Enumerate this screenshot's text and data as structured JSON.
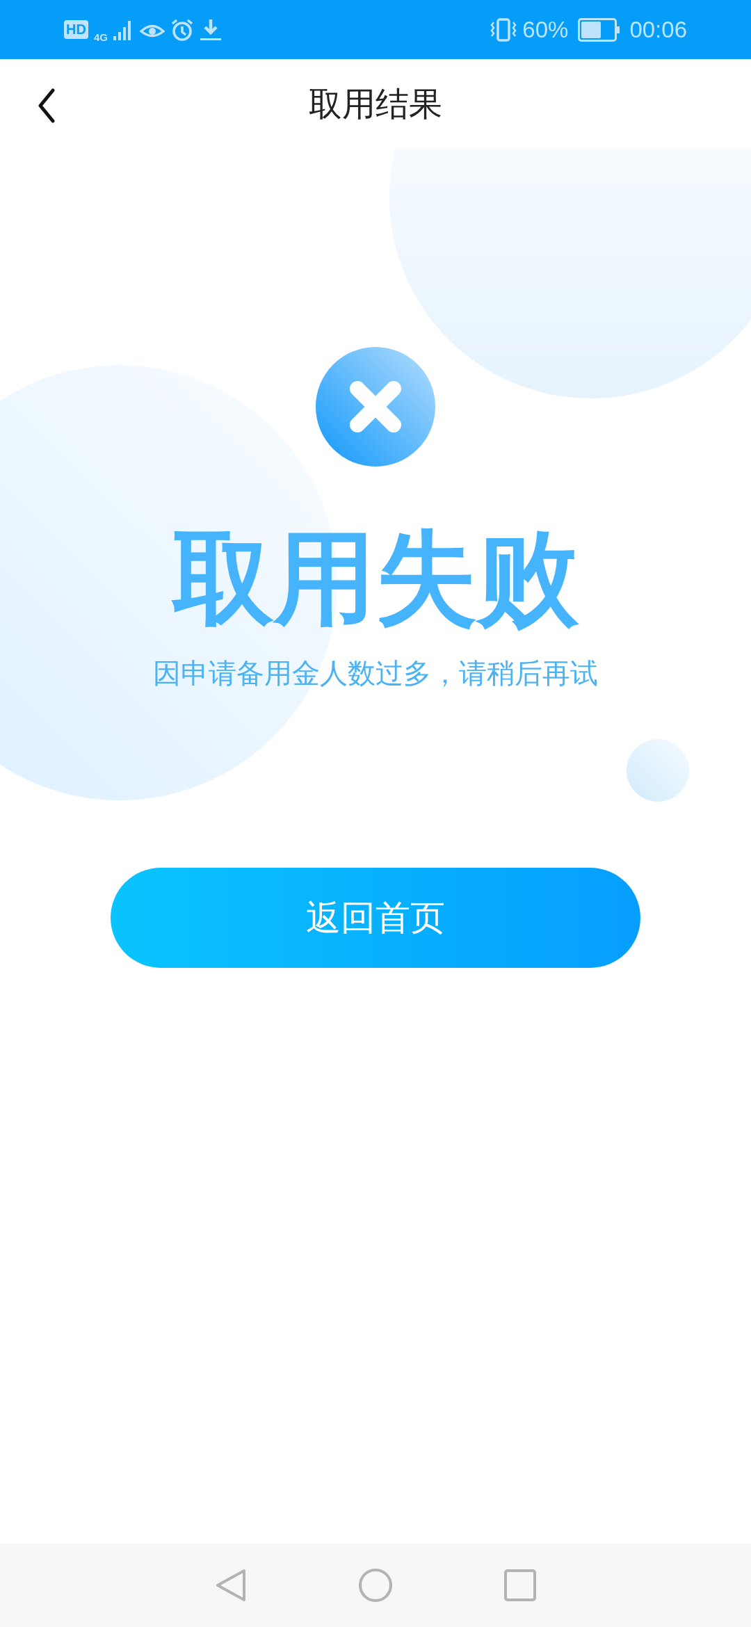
{
  "status_bar": {
    "hd_badge": "HD",
    "network": "4G",
    "battery": "60%",
    "battery_icon": {
      "level": 0.6
    },
    "time": "00:06"
  },
  "header": {
    "title": "取用结果"
  },
  "result": {
    "title": "取用失败",
    "message": "因申请备用金人数过多，请稍后再试"
  },
  "button": {
    "label": "返回首页"
  }
}
